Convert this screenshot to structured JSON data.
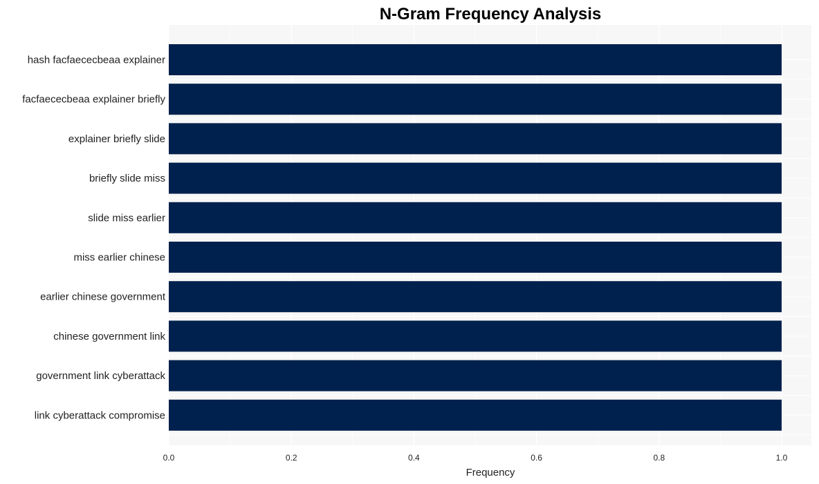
{
  "chart_data": {
    "type": "bar",
    "orientation": "horizontal",
    "title": "N-Gram Frequency Analysis",
    "xlabel": "Frequency",
    "ylabel": "",
    "xlim": [
      0,
      1.05
    ],
    "xticks": [
      "0.0",
      "0.2",
      "0.4",
      "0.6",
      "0.8",
      "1.0"
    ],
    "xtick_values": [
      0,
      0.2,
      0.4,
      0.6,
      0.8,
      1.0
    ],
    "grid": true,
    "categories": [
      "hash facfaececbeaa explainer",
      "facfaececbeaa explainer briefly",
      "explainer briefly slide",
      "briefly slide miss",
      "slide miss earlier",
      "miss earlier chinese",
      "earlier chinese government",
      "chinese government link",
      "government link cyberattack",
      "link cyberattack compromise"
    ],
    "values": [
      1,
      1,
      1,
      1,
      1,
      1,
      1,
      1,
      1,
      1
    ],
    "colors": {
      "bar": "#00214d",
      "plot_bg": "#f7f7f7",
      "grid": "#ffffff"
    }
  }
}
